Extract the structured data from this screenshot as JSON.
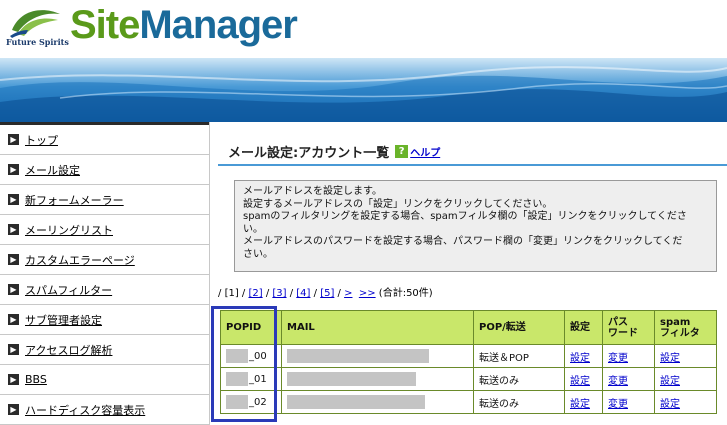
{
  "brand": {
    "tagline": "Future Spirits",
    "title_part1": "Site",
    "title_part2": "Manager"
  },
  "sidebar": {
    "items": [
      {
        "label": "トップ"
      },
      {
        "label": "メール設定"
      },
      {
        "label": "新フォームメーラー"
      },
      {
        "label": "メーリングリスト"
      },
      {
        "label": "カスタムエラーページ"
      },
      {
        "label": "スパムフィルター"
      },
      {
        "label": "サブ管理者設定"
      },
      {
        "label": "アクセスログ解析"
      },
      {
        "label": "BBS"
      },
      {
        "label": "ハードディスク容量表示"
      }
    ]
  },
  "main": {
    "title": "メール設定:アカウント一覧",
    "help_label": "ヘルプ",
    "help_icon_char": "?",
    "info_lines": [
      "メールアドレスを設定します。",
      "設定するメールアドレスの「設定」リンクをクリックしてください。",
      "spamのフィルタリングを設定する場合、spamフィルタ欄の「設定」リンクをクリックしてくださ",
      "い。",
      "メールアドレスのパスワードを設定する場合、パスワード欄の「変更」リンクをクリックしてくだ",
      "さい。"
    ],
    "pager": {
      "current": "[1]",
      "pages": [
        "[2]",
        "[3]",
        "[4]",
        "[5]"
      ],
      "next": ">",
      "last": ">>",
      "total": "(合計:50件)"
    },
    "table": {
      "headers": {
        "popid": "POPID",
        "mail": "MAIL",
        "pop": "POP/転送",
        "setting": "設定",
        "password_line1": "パス",
        "password_line2": "ワード",
        "spam_line1": "spam",
        "spam_line2": "フィルタ"
      },
      "rows": [
        {
          "popid_suffix": "_00",
          "mail_mask_fraction": 0.78,
          "pop": "転送＆POP",
          "setting": "設定",
          "password": "変更",
          "spam": "設定"
        },
        {
          "popid_suffix": "_01",
          "mail_mask_fraction": 0.71,
          "pop": "転送のみ",
          "setting": "設定",
          "password": "変更",
          "spam": "設定"
        },
        {
          "popid_suffix": "_02",
          "mail_mask_fraction": 0.76,
          "pop": "転送のみ",
          "setting": "設定",
          "password": "変更",
          "spam": "設定"
        }
      ]
    }
  },
  "colors": {
    "brand_green": "#5a9a1a",
    "brand_blue": "#1a6a9a",
    "table_header": "#c9e76a",
    "link": "#0000cc",
    "highlight_box": "#2a3ab8"
  }
}
